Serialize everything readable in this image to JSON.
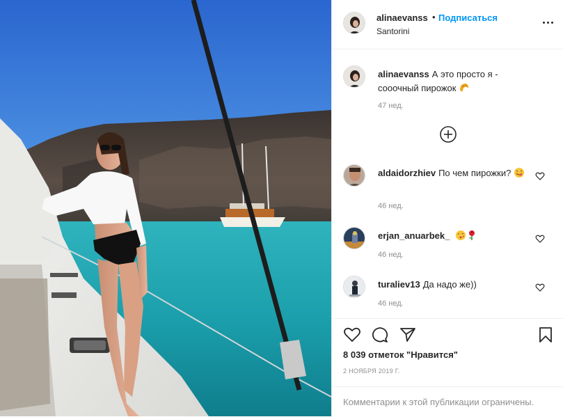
{
  "author": {
    "username": "alinaevanss",
    "separator": "•",
    "follow_label": "Подписаться",
    "location": "Santorini"
  },
  "caption": {
    "username": "alinaevanss",
    "text": "А это просто я - сооочный пирожок",
    "emoji": "croissant-emoji",
    "time": "47 нед."
  },
  "comments": [
    {
      "username": "aldaidorzhiev",
      "text": "По чем пирожки?",
      "emoji": "yum-emoji",
      "time": "46 нед."
    },
    {
      "username": "erjan_anuarbek_",
      "text": "",
      "emoji": "kiss-rose-emoji",
      "time": "46 нед."
    },
    {
      "username": "turaliev13",
      "text": "Да надо же))",
      "emoji": "",
      "time": "46 нед."
    }
  ],
  "stats": {
    "likes_label": "8 039 отметок \"Нравится\"",
    "date": "2 НОЯБРЯ 2019 Г."
  },
  "footer": {
    "restricted_text": "Комментарии к этой публикации ограничены."
  },
  "icons": {
    "more": "more-options-icon",
    "load_more": "plus-circle-icon",
    "like": "heart-icon",
    "comment": "comment-icon",
    "share": "paper-plane-icon",
    "save": "bookmark-icon"
  },
  "colors": {
    "accent": "#0095f6",
    "text": "#262626",
    "muted": "#8e8e8e",
    "border": "#efefef"
  }
}
